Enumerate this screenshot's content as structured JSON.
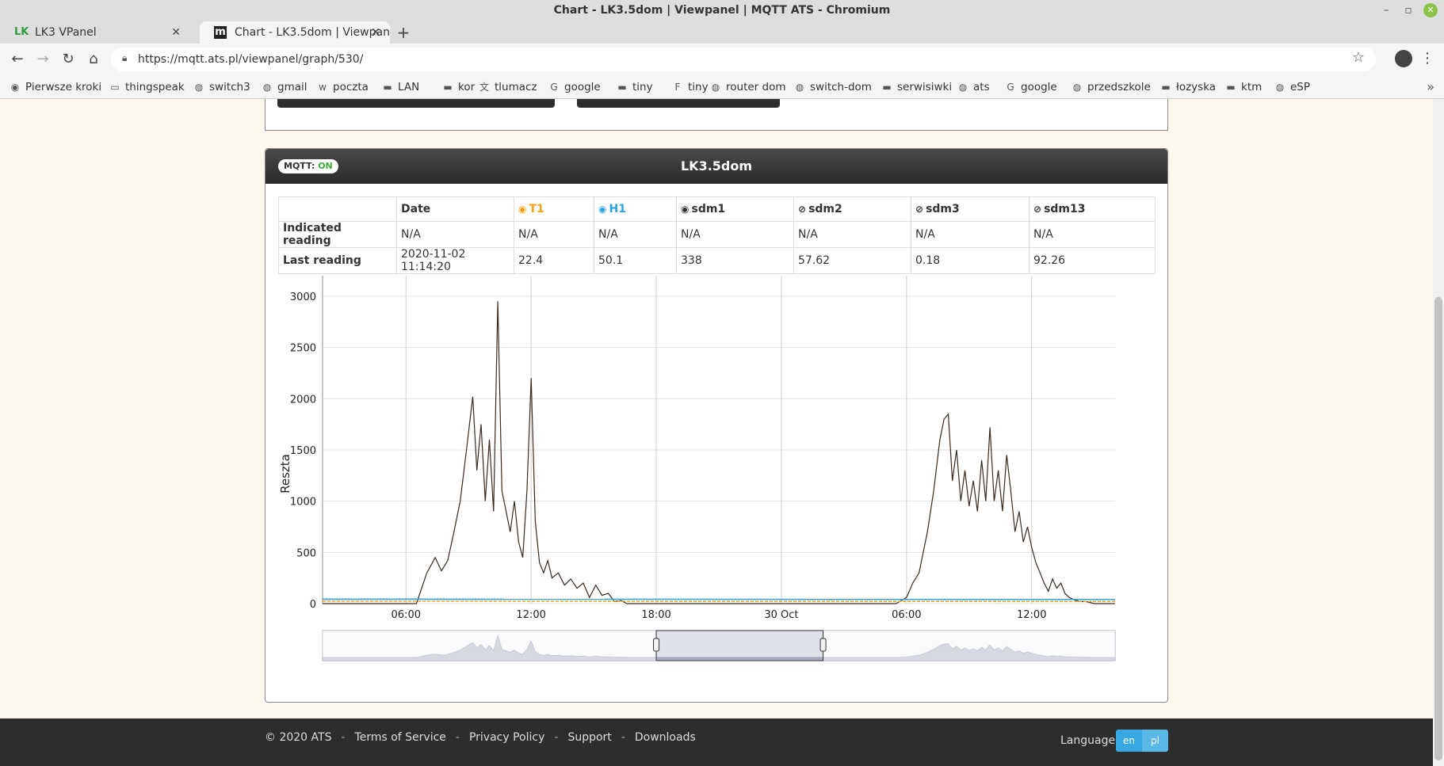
{
  "window": {
    "title": "Chart - LK3.5dom | Viewpanel | MQTT ATS - Chromium"
  },
  "tabs": [
    {
      "label": "LK3 VPanel",
      "icon": "lk-logo-icon"
    },
    {
      "label": "Chart - LK3.5dom | Viewpanel",
      "icon": "m-logo-icon"
    }
  ],
  "address": {
    "url": "https://mqtt.ats.pl/viewpanel/graph/530/"
  },
  "bookmarks": [
    {
      "label": "Pierwsze kroki",
      "icon": "firefox-icon"
    },
    {
      "label": "thingspeak",
      "icon": "monitor-icon"
    },
    {
      "label": "switch3",
      "icon": "globe-icon"
    },
    {
      "label": "gmail",
      "icon": "globe-icon"
    },
    {
      "label": "poczta",
      "icon": "wp-icon"
    },
    {
      "label": "LAN",
      "icon": "folder-icon"
    },
    {
      "label": "kor",
      "icon": "folder-icon"
    },
    {
      "label": "tlumacz",
      "icon": "translate-icon"
    },
    {
      "label": "google",
      "icon": "google-icon"
    },
    {
      "label": "tiny",
      "icon": "folder-icon"
    },
    {
      "label": "tiny",
      "icon": "ff-icon"
    },
    {
      "label": "router dom",
      "icon": "globe-icon"
    },
    {
      "label": "switch-dom",
      "icon": "globe-icon"
    },
    {
      "label": "serwisiwki",
      "icon": "folder-icon"
    },
    {
      "label": "ats",
      "icon": "globe-icon"
    },
    {
      "label": "google",
      "icon": "google-icon"
    },
    {
      "label": "przedszkole",
      "icon": "globe-icon"
    },
    {
      "label": "łozyska",
      "icon": "folder-icon"
    },
    {
      "label": "ktm",
      "icon": "folder-icon"
    },
    {
      "label": "eSP",
      "icon": "globe-icon"
    }
  ],
  "panel": {
    "mqtt_label": "MQTT:",
    "mqtt_state": "ON",
    "title": "LK3.5dom"
  },
  "table": {
    "headers": [
      "",
      "Date",
      "T1",
      "H1",
      "sdm1",
      "sdm2",
      "sdm3",
      "sdm13"
    ],
    "rows": [
      {
        "label": "Indicated reading",
        "cells": [
          "N/A",
          "N/A",
          "N/A",
          "N/A",
          "N/A",
          "N/A",
          "N/A"
        ]
      },
      {
        "label": "Last reading",
        "cells": [
          "2020-11-02 11:14:20",
          "22.4",
          "50.1",
          "338",
          "57.62",
          "0.18",
          "92.26"
        ]
      }
    ]
  },
  "colors": {
    "t1": "#f4a213",
    "h1": "#2aa3e0",
    "line": "#3a2a20",
    "accent": "#37a8e1"
  },
  "chart_data": {
    "type": "line",
    "ylabel": "Reszta",
    "ylim": [
      0,
      3200
    ],
    "yticks": [
      0,
      500,
      1000,
      1500,
      2000,
      2500,
      3000
    ],
    "xlim": [
      2.0,
      40.0
    ],
    "xticks": [
      {
        "value": 6,
        "label": "06:00"
      },
      {
        "value": 12,
        "label": "12:00"
      },
      {
        "value": 18,
        "label": "18:00"
      },
      {
        "value": 24,
        "label": "30 Oct"
      },
      {
        "value": 30,
        "label": "06:00"
      },
      {
        "value": 36,
        "label": "12:00"
      }
    ],
    "grid": true,
    "series": [
      {
        "x": [
          2.0,
          5.5,
          6.5,
          7.0,
          7.4,
          7.7,
          8.0,
          8.3,
          8.6,
          8.9,
          9.2,
          9.4,
          9.6,
          9.8,
          10.0,
          10.2,
          10.4,
          10.6,
          10.8,
          11.0,
          11.2,
          11.4,
          11.6,
          11.8,
          12.0,
          12.2,
          12.4,
          12.6,
          12.8,
          13.0,
          13.3,
          13.6,
          13.9,
          14.2,
          14.5,
          14.8,
          15.1,
          15.4,
          15.7,
          16.0,
          16.3,
          16.6,
          17.0,
          17.5,
          18.0,
          22.0,
          26.0,
          28.5,
          29.5,
          30.0,
          30.3,
          30.6,
          31.0,
          31.3,
          31.6,
          31.8,
          32.0,
          32.2,
          32.4,
          32.6,
          32.8,
          33.0,
          33.2,
          33.4,
          33.6,
          33.8,
          34.0,
          34.2,
          34.4,
          34.6,
          34.8,
          35.0,
          35.2,
          35.4,
          35.6,
          35.8,
          36.0,
          36.2,
          36.4,
          36.6,
          36.8,
          37.0,
          37.2,
          37.4,
          37.6,
          37.8,
          38.0,
          38.3,
          38.6,
          39.0,
          39.5,
          40.0
        ],
        "y": [
          0,
          0,
          0,
          300,
          450,
          320,
          420,
          700,
          1000,
          1500,
          2020,
          1300,
          1750,
          1000,
          1600,
          900,
          2950,
          1100,
          900,
          700,
          1000,
          600,
          450,
          1100,
          2200,
          800,
          400,
          300,
          420,
          250,
          300,
          180,
          240,
          150,
          200,
          60,
          180,
          80,
          100,
          20,
          30,
          0,
          0,
          0,
          0,
          0,
          0,
          0,
          0,
          60,
          200,
          300,
          700,
          1100,
          1600,
          1800,
          1850,
          1200,
          1500,
          1000,
          1300,
          950,
          1200,
          900,
          1400,
          1000,
          1720,
          1000,
          1300,
          900,
          1450,
          1100,
          700,
          900,
          600,
          750,
          550,
          400,
          300,
          200,
          120,
          240,
          150,
          200,
          100,
          60,
          40,
          20,
          20,
          0,
          0,
          0
        ]
      },
      {
        "x": [
          2.0,
          40.0
        ],
        "y": [
          45,
          40
        ]
      },
      {
        "x": [
          2.0,
          40.0
        ],
        "y": [
          25,
          20
        ]
      }
    ],
    "navigator": {
      "range": [
        18.0,
        26.0
      ]
    }
  },
  "footer": {
    "copyright": "© 2020 ATS",
    "links": [
      "Terms of Service",
      "Privacy Policy",
      "Support",
      "Downloads"
    ],
    "language_label": "Language:",
    "languages": [
      "en",
      "pl"
    ]
  }
}
